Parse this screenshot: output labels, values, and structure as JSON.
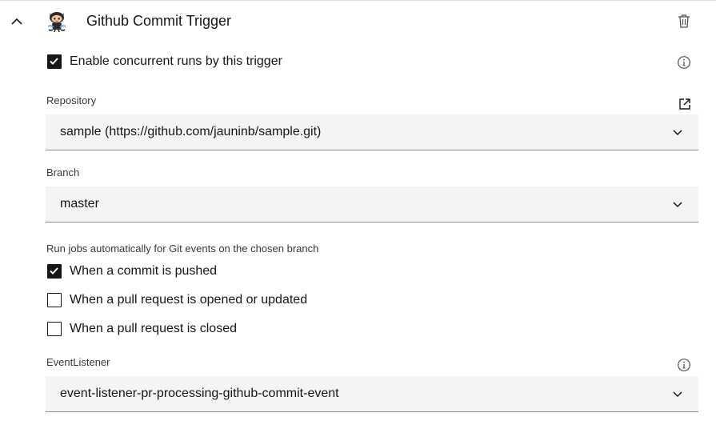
{
  "trigger": {
    "title": "Github Commit Trigger",
    "concurrent_label": "Enable concurrent runs by this trigger",
    "concurrent_checked": true
  },
  "repository": {
    "label": "Repository",
    "value": "sample (https://github.com/jauninb/sample.git)"
  },
  "branch": {
    "label": "Branch",
    "value": "master"
  },
  "events": {
    "heading": "Run jobs automatically for Git events on the chosen branch",
    "options": [
      {
        "label": "When a commit is pushed",
        "checked": true
      },
      {
        "label": "When a pull request is opened or updated",
        "checked": false
      },
      {
        "label": "When a pull request is closed",
        "checked": false
      }
    ]
  },
  "event_listener": {
    "label": "EventListener",
    "value": "event-listener-pr-processing-github-commit-event"
  },
  "colors": {
    "text": "#161616",
    "field_bg": "#f4f4f4",
    "field_border": "#8d8d8d",
    "label": "#393939"
  },
  "icons": [
    "chevron-up-icon",
    "github-octocat-icon",
    "trash-icon",
    "info-icon",
    "external-link-icon",
    "chevron-down-icon",
    "checkmark-icon"
  ]
}
